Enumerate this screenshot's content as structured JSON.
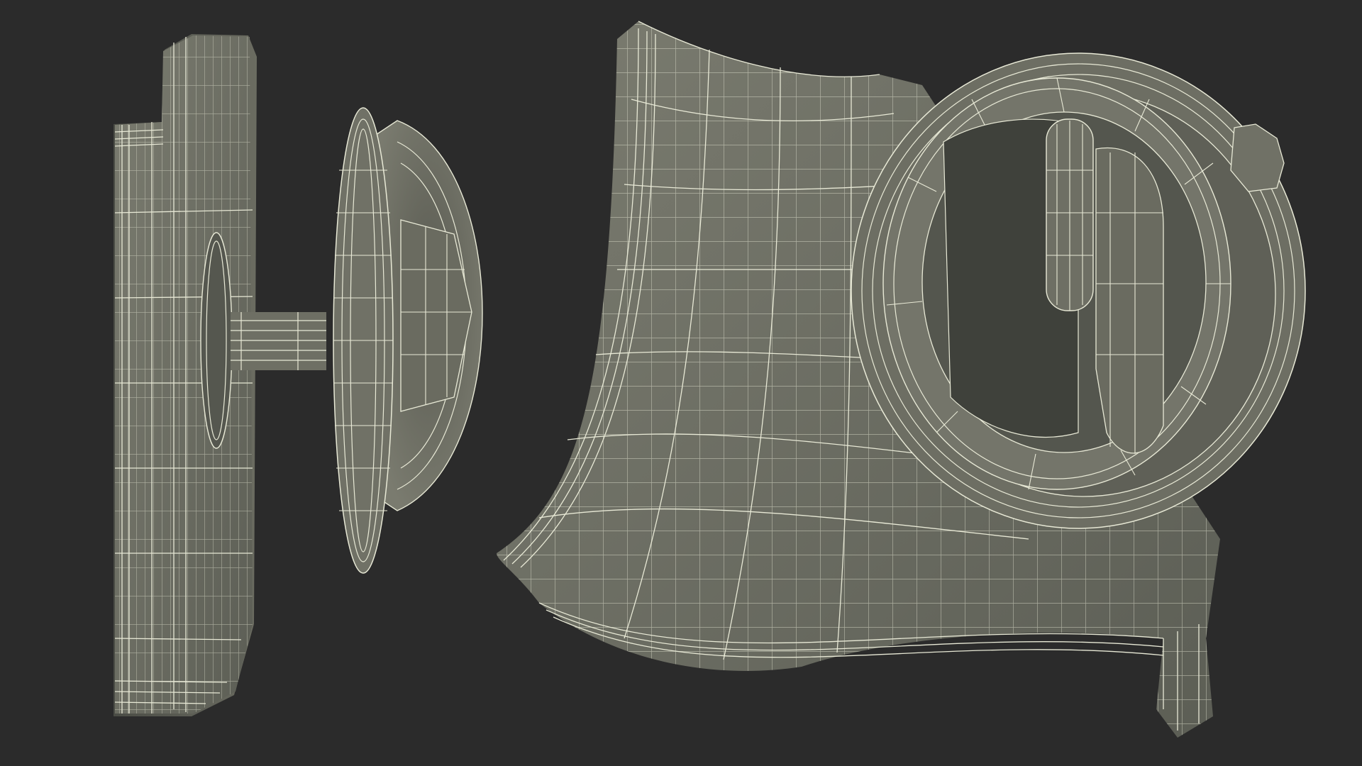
{
  "scene": {
    "background_color": "#2b2b2b",
    "surface_color": "#6f7064",
    "surface_dark_color": "#4e5048",
    "wire_color": "#e8e9d6",
    "objects": [
      {
        "name": "side-view-model",
        "kind": "wireframe mesh",
        "view": "side"
      },
      {
        "name": "perspective-view-model",
        "kind": "wireframe mesh",
        "view": "three-quarter"
      }
    ]
  }
}
